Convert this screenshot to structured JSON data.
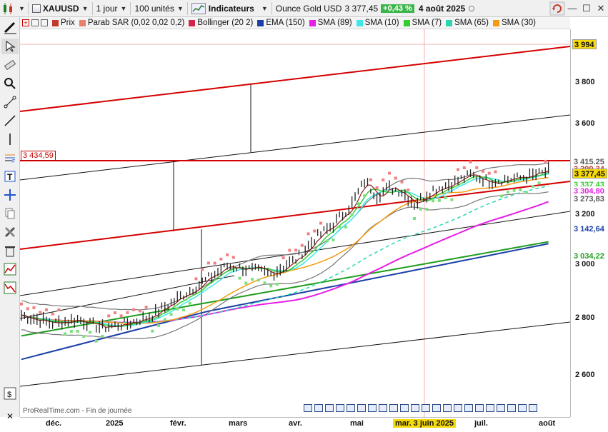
{
  "toolbar": {
    "symbol": "XAUUSD",
    "timeframe": "1 jour",
    "units": "100 unités",
    "indicators_label": "Indicateurs",
    "instrument_name": "Ounce Gold USD",
    "last_price": "3 377,45",
    "change": "+0,43 %",
    "date": "4 août 2025"
  },
  "legend": [
    {
      "label": "Prix",
      "color": "#c0392b",
      "icon": "bars-icon"
    },
    {
      "label": "Parab SAR (0,02 0,02 0,2)",
      "color": "#e8806a",
      "icon": "sar-icon"
    },
    {
      "label": "Bollinger (20 2)",
      "color": "#d4244e",
      "icon": "bollinger-icon"
    },
    {
      "label": "EMA (150)",
      "color": "#1a3fa6",
      "icon": "ema-icon"
    },
    {
      "label": "SMA (89)",
      "color": "#e61ee6",
      "icon": "sma-icon"
    },
    {
      "label": "SMA (10)",
      "color": "#3ee8e8",
      "icon": "sma-icon"
    },
    {
      "label": "SMA (7)",
      "color": "#33cc33",
      "icon": "sma-icon"
    },
    {
      "label": "SMA (65)",
      "color": "#2ad6b0",
      "icon": "sma-icon"
    },
    {
      "label": "SMA (30)",
      "color": "#f39c12",
      "icon": "sma-icon"
    }
  ],
  "price_axis": {
    "ticks": [
      "3 800",
      "3 600",
      "3 200",
      "3 000",
      "2 800",
      "2 600"
    ],
    "tags": [
      {
        "text": "3 994",
        "bg": "#f5d90a",
        "fg": "#111111"
      },
      {
        "text": "3 415,25",
        "bg": "#ffffff",
        "fg": "#555555"
      },
      {
        "text": "3 399,34",
        "bg": "#ffffff",
        "fg": "#c0392b"
      },
      {
        "text": "3 377,45",
        "bg": "#f5d90a",
        "fg": "#111111"
      },
      {
        "text": "3 337,43",
        "bg": "#ffffff",
        "fg": "#33cc33"
      },
      {
        "text": "3 304,80",
        "bg": "#ffffff",
        "fg": "#e61ee6"
      },
      {
        "text": "3 273,83",
        "bg": "#ffffff",
        "fg": "#555555"
      },
      {
        "text": "3 142,64",
        "bg": "#ffffff",
        "fg": "#1a3fa6"
      },
      {
        "text": "3 034,22",
        "bg": "#ffffff",
        "fg": "#1d9e1d"
      }
    ]
  },
  "date_axis": [
    "déc.",
    "2025",
    "févr.",
    "mars",
    "avr.",
    "mai",
    "mar. 3 juin 2025",
    "juil.",
    "août"
  ],
  "chart": {
    "level_label": "3 434,59",
    "watermark": "ProRealTime.com - Fin de journée"
  },
  "colors": {
    "accent_red": "#d40000",
    "positive": "#3bb54a",
    "highlight": "#f5d90a"
  }
}
